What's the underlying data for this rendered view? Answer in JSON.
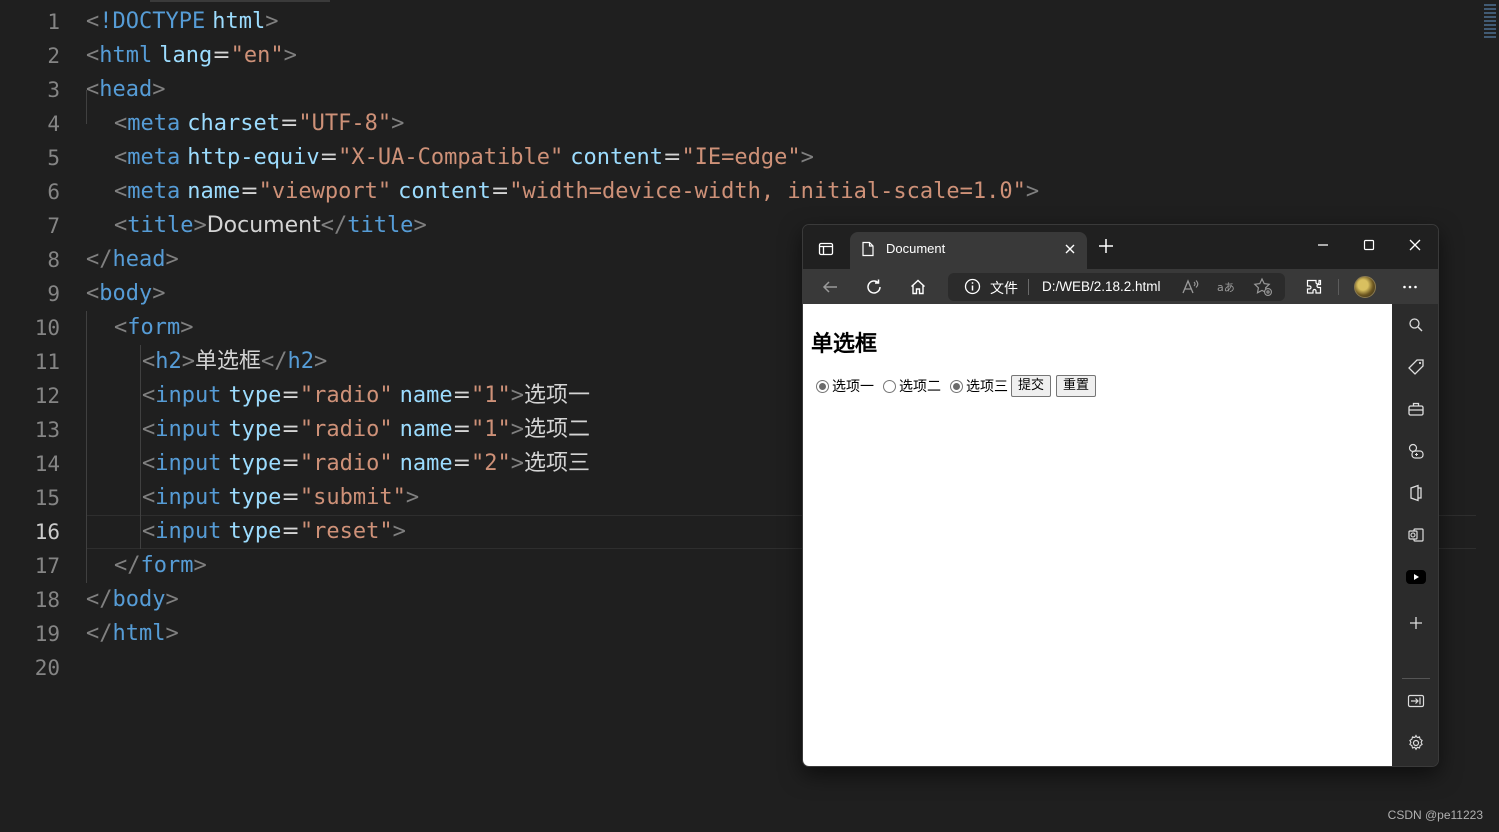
{
  "editor": {
    "line_numbers": [
      "1",
      "2",
      "3",
      "4",
      "5",
      "6",
      "7",
      "8",
      "9",
      "10",
      "11",
      "12",
      "13",
      "14",
      "15",
      "16",
      "17",
      "18",
      "19",
      "20"
    ],
    "active_line": "16",
    "lines": [
      [
        {
          "t": "punc",
          "v": "<"
        },
        {
          "t": "tag",
          "v": "!DOCTYPE"
        },
        {
          "t": "text",
          "v": " "
        },
        {
          "t": "attr",
          "v": "html"
        },
        {
          "t": "punc",
          "v": ">"
        }
      ],
      [
        {
          "t": "punc",
          "v": "<"
        },
        {
          "t": "tag",
          "v": "html"
        },
        {
          "t": "text",
          "v": " "
        },
        {
          "t": "attr",
          "v": "lang"
        },
        {
          "t": "text",
          "v": "="
        },
        {
          "t": "str",
          "v": "\"en\""
        },
        {
          "t": "punc",
          "v": ">"
        }
      ],
      [
        {
          "t": "punc",
          "v": "<"
        },
        {
          "t": "tag",
          "v": "head"
        },
        {
          "t": "punc",
          "v": ">"
        }
      ],
      [
        {
          "t": "text",
          "v": "    "
        },
        {
          "t": "punc",
          "v": "<"
        },
        {
          "t": "tag",
          "v": "meta"
        },
        {
          "t": "text",
          "v": " "
        },
        {
          "t": "attr",
          "v": "charset"
        },
        {
          "t": "text",
          "v": "="
        },
        {
          "t": "str",
          "v": "\"UTF-8\""
        },
        {
          "t": "punc",
          "v": ">"
        }
      ],
      [
        {
          "t": "text",
          "v": "    "
        },
        {
          "t": "punc",
          "v": "<"
        },
        {
          "t": "tag",
          "v": "meta"
        },
        {
          "t": "text",
          "v": " "
        },
        {
          "t": "attr",
          "v": "http-equiv"
        },
        {
          "t": "text",
          "v": "="
        },
        {
          "t": "str",
          "v": "\"X-UA-Compatible\""
        },
        {
          "t": "text",
          "v": " "
        },
        {
          "t": "attr",
          "v": "content"
        },
        {
          "t": "text",
          "v": "="
        },
        {
          "t": "str",
          "v": "\"IE=edge\""
        },
        {
          "t": "punc",
          "v": ">"
        }
      ],
      [
        {
          "t": "text",
          "v": "    "
        },
        {
          "t": "punc",
          "v": "<"
        },
        {
          "t": "tag",
          "v": "meta"
        },
        {
          "t": "text",
          "v": " "
        },
        {
          "t": "attr",
          "v": "name"
        },
        {
          "t": "text",
          "v": "="
        },
        {
          "t": "str",
          "v": "\"viewport\""
        },
        {
          "t": "text",
          "v": " "
        },
        {
          "t": "attr",
          "v": "content"
        },
        {
          "t": "text",
          "v": "="
        },
        {
          "t": "str",
          "v": "\"width=device-width, initial-scale=1.0\""
        },
        {
          "t": "punc",
          "v": ">"
        }
      ],
      [
        {
          "t": "text",
          "v": "    "
        },
        {
          "t": "punc",
          "v": "<"
        },
        {
          "t": "tag",
          "v": "title"
        },
        {
          "t": "punc",
          "v": ">"
        },
        {
          "t": "text",
          "v": "Document"
        },
        {
          "t": "punc",
          "v": "</"
        },
        {
          "t": "tag",
          "v": "title"
        },
        {
          "t": "punc",
          "v": ">"
        }
      ],
      [
        {
          "t": "punc",
          "v": "</"
        },
        {
          "t": "tag",
          "v": "head"
        },
        {
          "t": "punc",
          "v": ">"
        }
      ],
      [
        {
          "t": "punc",
          "v": "<"
        },
        {
          "t": "tag",
          "v": "body"
        },
        {
          "t": "punc",
          "v": ">"
        }
      ],
      [
        {
          "t": "text",
          "v": "    "
        },
        {
          "t": "punc",
          "v": "<"
        },
        {
          "t": "tag",
          "v": "form"
        },
        {
          "t": "punc",
          "v": ">"
        }
      ],
      [
        {
          "t": "text",
          "v": "        "
        },
        {
          "t": "punc",
          "v": "<"
        },
        {
          "t": "tag",
          "v": "h2"
        },
        {
          "t": "punc",
          "v": ">"
        },
        {
          "t": "text",
          "v": "单选框"
        },
        {
          "t": "punc",
          "v": "</"
        },
        {
          "t": "tag",
          "v": "h2"
        },
        {
          "t": "punc",
          "v": ">"
        }
      ],
      [
        {
          "t": "text",
          "v": "        "
        },
        {
          "t": "punc",
          "v": "<"
        },
        {
          "t": "tag",
          "v": "input"
        },
        {
          "t": "text",
          "v": " "
        },
        {
          "t": "attr",
          "v": "type"
        },
        {
          "t": "text",
          "v": "="
        },
        {
          "t": "str",
          "v": "\"radio\""
        },
        {
          "t": "text",
          "v": " "
        },
        {
          "t": "attr",
          "v": "name"
        },
        {
          "t": "text",
          "v": "="
        },
        {
          "t": "str",
          "v": "\"1\""
        },
        {
          "t": "punc",
          "v": ">"
        },
        {
          "t": "text",
          "v": "选项一"
        }
      ],
      [
        {
          "t": "text",
          "v": "        "
        },
        {
          "t": "punc",
          "v": "<"
        },
        {
          "t": "tag",
          "v": "input"
        },
        {
          "t": "text",
          "v": " "
        },
        {
          "t": "attr",
          "v": "type"
        },
        {
          "t": "text",
          "v": "="
        },
        {
          "t": "str",
          "v": "\"radio\""
        },
        {
          "t": "text",
          "v": " "
        },
        {
          "t": "attr",
          "v": "name"
        },
        {
          "t": "text",
          "v": "="
        },
        {
          "t": "str",
          "v": "\"1\""
        },
        {
          "t": "punc",
          "v": ">"
        },
        {
          "t": "text",
          "v": "选项二"
        }
      ],
      [
        {
          "t": "text",
          "v": "        "
        },
        {
          "t": "punc",
          "v": "<"
        },
        {
          "t": "tag",
          "v": "input"
        },
        {
          "t": "text",
          "v": " "
        },
        {
          "t": "attr",
          "v": "type"
        },
        {
          "t": "text",
          "v": "="
        },
        {
          "t": "str",
          "v": "\"radio\""
        },
        {
          "t": "text",
          "v": " "
        },
        {
          "t": "attr",
          "v": "name"
        },
        {
          "t": "text",
          "v": "="
        },
        {
          "t": "str",
          "v": "\"2\""
        },
        {
          "t": "punc",
          "v": ">"
        },
        {
          "t": "text",
          "v": "选项三"
        }
      ],
      [
        {
          "t": "text",
          "v": "        "
        },
        {
          "t": "punc",
          "v": "<"
        },
        {
          "t": "tag",
          "v": "input"
        },
        {
          "t": "text",
          "v": " "
        },
        {
          "t": "attr",
          "v": "type"
        },
        {
          "t": "text",
          "v": "="
        },
        {
          "t": "str",
          "v": "\"submit\""
        },
        {
          "t": "punc",
          "v": ">"
        }
      ],
      [
        {
          "t": "text",
          "v": "        "
        },
        {
          "t": "punc",
          "v": "<"
        },
        {
          "t": "tag",
          "v": "input"
        },
        {
          "t": "text",
          "v": " "
        },
        {
          "t": "attr",
          "v": "type"
        },
        {
          "t": "text",
          "v": "="
        },
        {
          "t": "str",
          "v": "\"reset\""
        },
        {
          "t": "punc",
          "v": ">"
        }
      ],
      [
        {
          "t": "text",
          "v": "    "
        },
        {
          "t": "punc",
          "v": "</"
        },
        {
          "t": "tag",
          "v": "form"
        },
        {
          "t": "punc",
          "v": ">"
        }
      ],
      [
        {
          "t": "punc",
          "v": "</"
        },
        {
          "t": "tag",
          "v": "body"
        },
        {
          "t": "punc",
          "v": ">"
        }
      ],
      [
        {
          "t": "punc",
          "v": "</"
        },
        {
          "t": "tag",
          "v": "html"
        },
        {
          "t": "punc",
          "v": ">"
        }
      ],
      []
    ]
  },
  "browser": {
    "tab_title": "Document",
    "address": {
      "label": "文件",
      "url": "D:/WEB/2.18.2.html"
    },
    "page": {
      "heading": "单选框",
      "options": [
        {
          "label": "选项一",
          "checked": true
        },
        {
          "label": "选项二",
          "checked": false
        },
        {
          "label": "选项三",
          "checked": true
        }
      ],
      "submit_label": "提交",
      "reset_label": "重置"
    }
  },
  "watermark": "CSDN @pe11223",
  "colors": {
    "editor_bg": "#1f1f1f",
    "tag": "#569cd6",
    "attr": "#9cdcfe",
    "string": "#ce9178",
    "punctuation": "#808080",
    "text": "#d4d4d4"
  }
}
